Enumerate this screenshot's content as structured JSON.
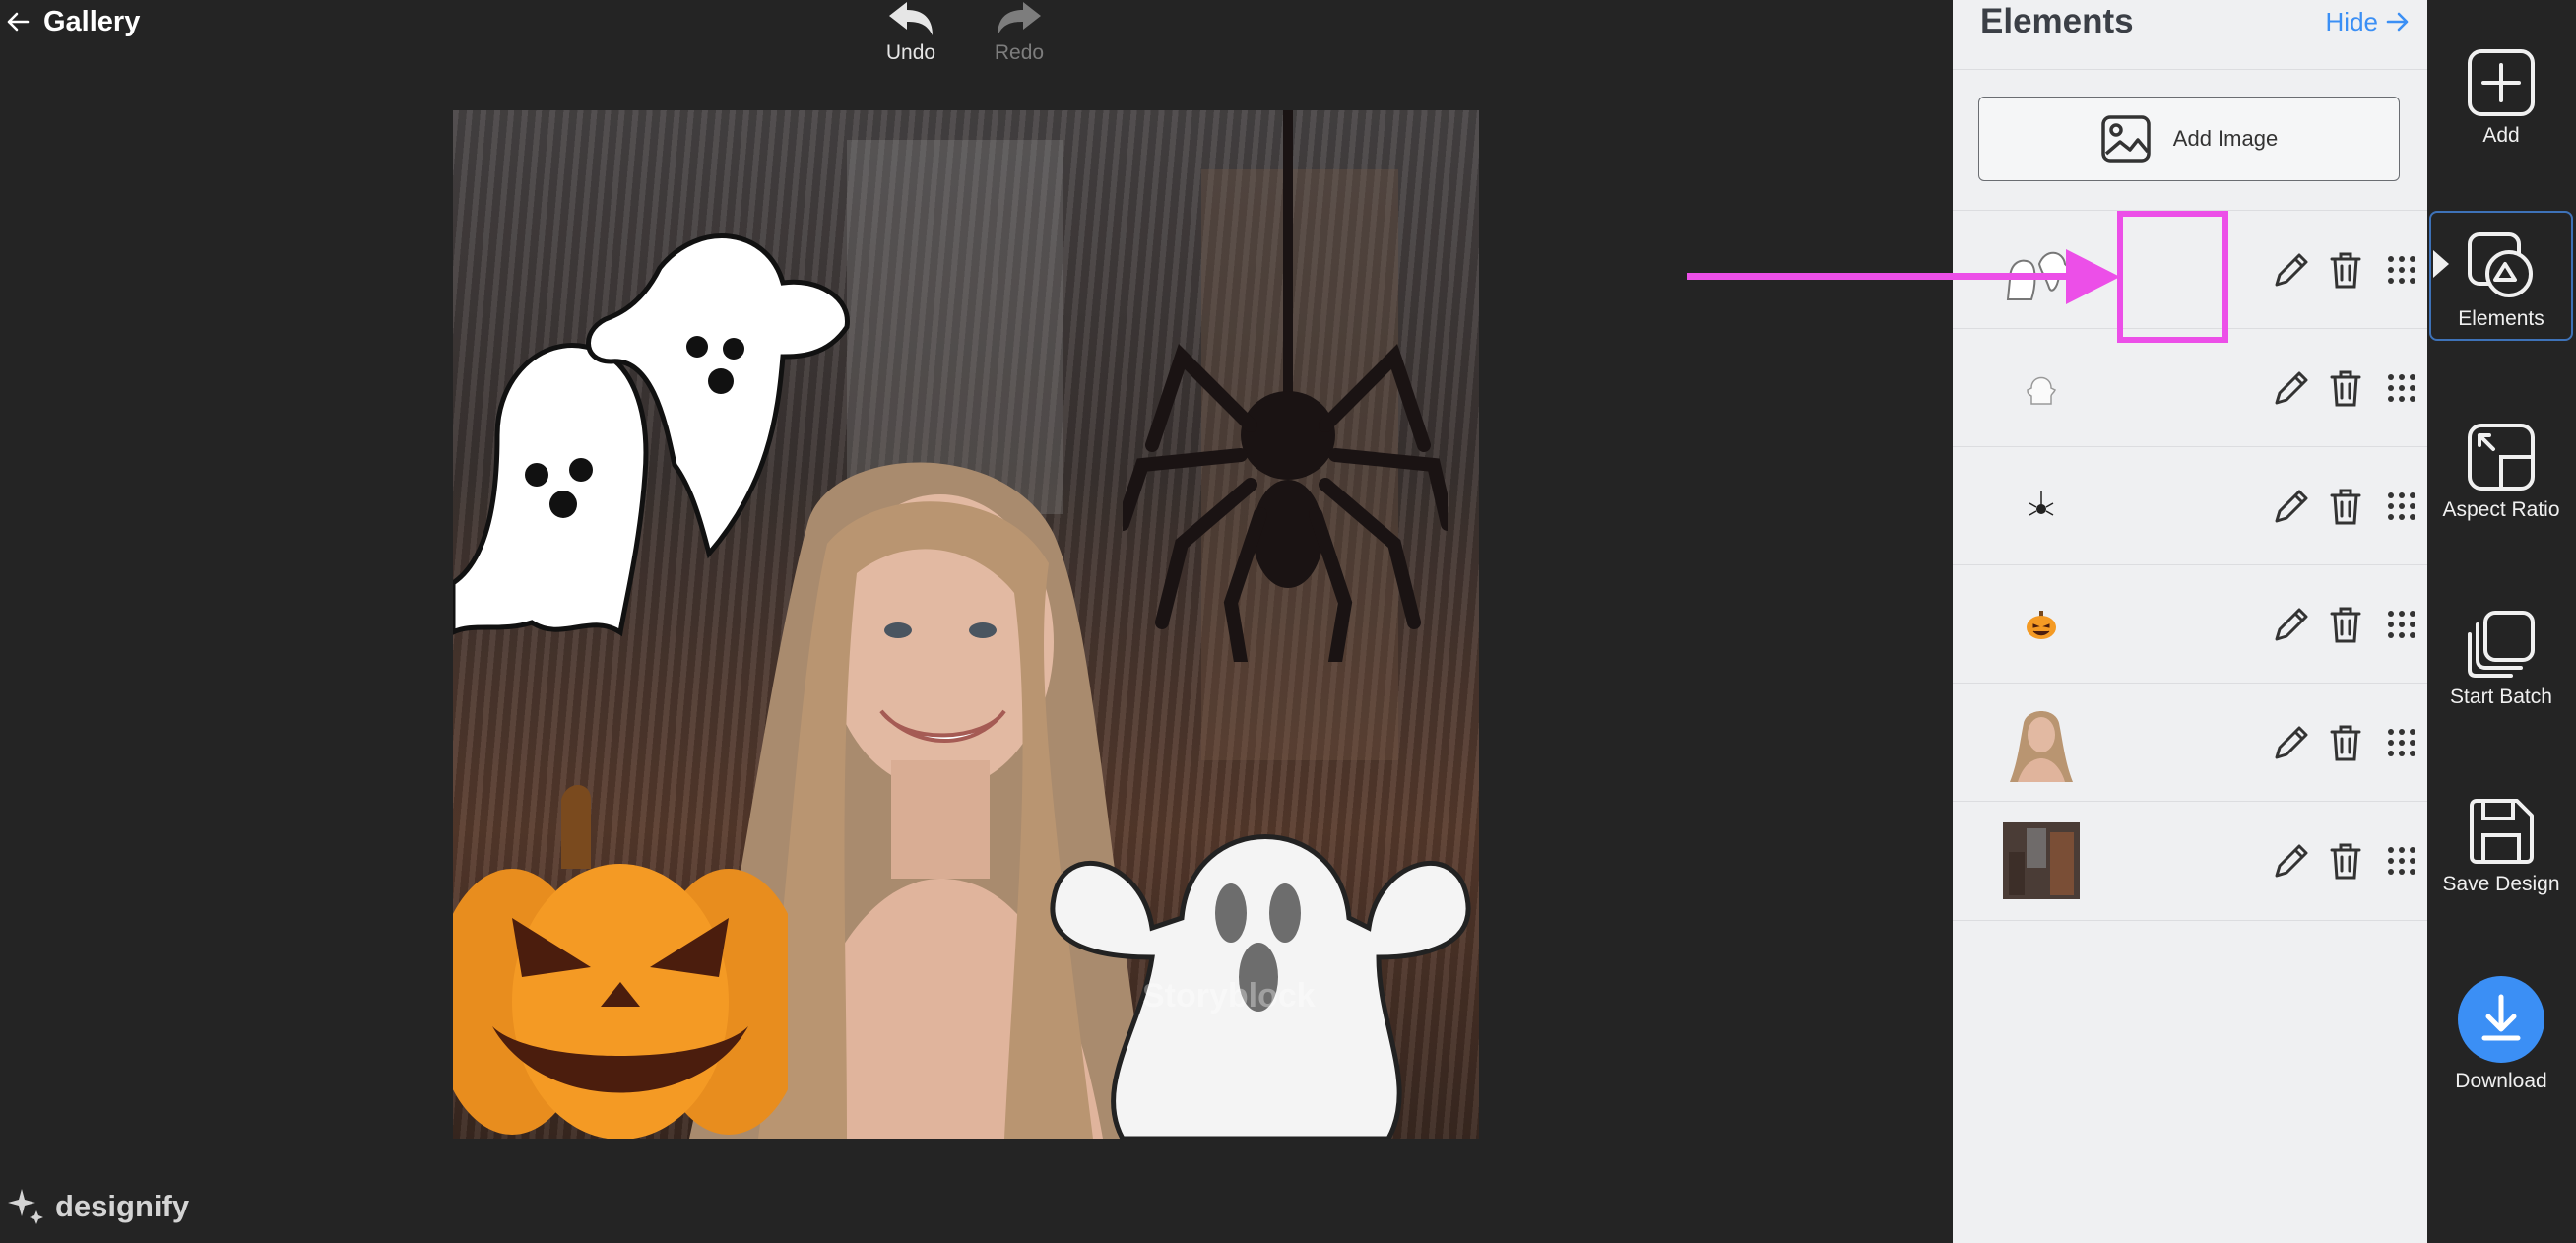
{
  "topbar": {
    "back_label": "Gallery",
    "undo_label": "Undo",
    "redo_label": "Redo"
  },
  "canvas": {
    "watermark": "Storyblock"
  },
  "panel": {
    "title": "Elements",
    "hide_label": "Hide",
    "add_image_label": "Add Image",
    "layers": [
      {
        "thumb": "ghosts-icon"
      },
      {
        "thumb": "ghost-small-icon"
      },
      {
        "thumb": "spider-icon"
      },
      {
        "thumb": "pumpkin-icon"
      },
      {
        "thumb": "portrait-photo"
      },
      {
        "thumb": "background-photo"
      }
    ]
  },
  "toolbar": {
    "add_label": "Add",
    "elements_label": "Elements",
    "aspect_label": "Aspect Ratio",
    "batch_label": "Start Batch",
    "save_label": "Save Design",
    "download_label": "Download"
  },
  "brand": {
    "name": "designify"
  },
  "colors": {
    "accent": "#3b8ff5",
    "annotation": "#ec4fe8",
    "panel_bg": "#eff0f2",
    "app_bg": "#242424"
  }
}
